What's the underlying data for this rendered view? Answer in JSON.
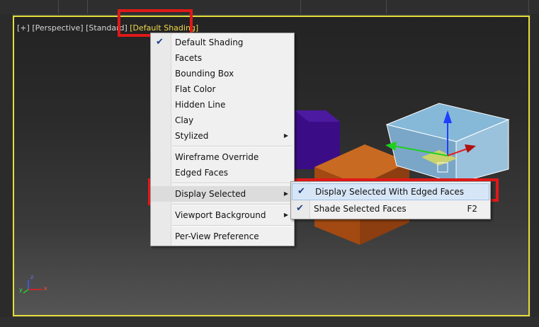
{
  "viewport": {
    "labels": {
      "plus": "[+]",
      "perspective": "[Perspective]",
      "standard": "[Standard]",
      "shading": "[Default Shading]"
    },
    "colors": {
      "border": "#e3dd3a",
      "highlight": "#e01818",
      "active_label": "#f1d94a"
    }
  },
  "shading_menu": {
    "items": [
      {
        "label": "Default Shading",
        "checked": true
      },
      {
        "label": "Facets"
      },
      {
        "label": "Bounding Box"
      },
      {
        "label": "Flat Color"
      },
      {
        "label": "Hidden Line"
      },
      {
        "label": "Clay"
      },
      {
        "label": "Stylized",
        "submenu": true
      },
      {
        "label": "Wireframe Override"
      },
      {
        "label": "Edged Faces"
      },
      {
        "label": "Display Selected",
        "submenu": true
      },
      {
        "label": "Viewport Background",
        "submenu": true
      },
      {
        "label": "Per-View Preference"
      }
    ]
  },
  "display_selected_submenu": {
    "items": [
      {
        "label": "Display Selected With Edged Faces",
        "checked": true
      },
      {
        "label": "Shade Selected Faces",
        "checked": true,
        "shortcut": "F2"
      }
    ]
  },
  "axis_tripod": {
    "x": "x",
    "y": "y",
    "z": "z"
  },
  "icons": {
    "check": "check-icon",
    "submenu_arrow": "submenu-arrow-icon"
  }
}
